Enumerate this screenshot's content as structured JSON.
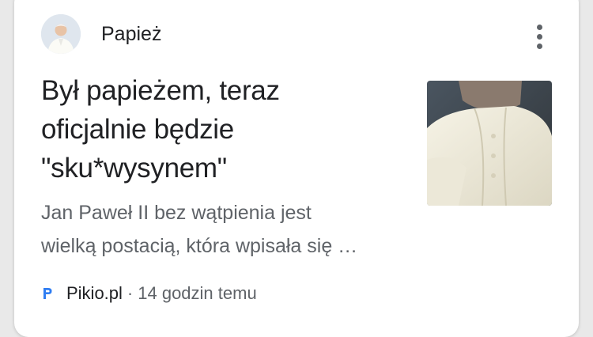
{
  "topic": {
    "label": "Papież",
    "avatar_icon": "pope-avatar"
  },
  "menu_icon": "more-vert-icon",
  "article": {
    "headline_lines": [
      "Był papieżem, teraz",
      "oficjalnie będzie",
      "\"sku*wysynem\""
    ],
    "snippet_lines": [
      "Jan Paweł II bez wątpienia jest",
      "wielką postacią, która wpisała się …"
    ],
    "thumbnail_icon": "pope-in-white-cassock-photo"
  },
  "source": {
    "favicon_icon": "pikio-favicon",
    "name": "Pikio.pl",
    "separator": "·",
    "time": "14 godzin temu"
  },
  "colors": {
    "favicon_blue": "#2f7df2",
    "text_primary": "#202124",
    "text_secondary": "#5f6368"
  }
}
